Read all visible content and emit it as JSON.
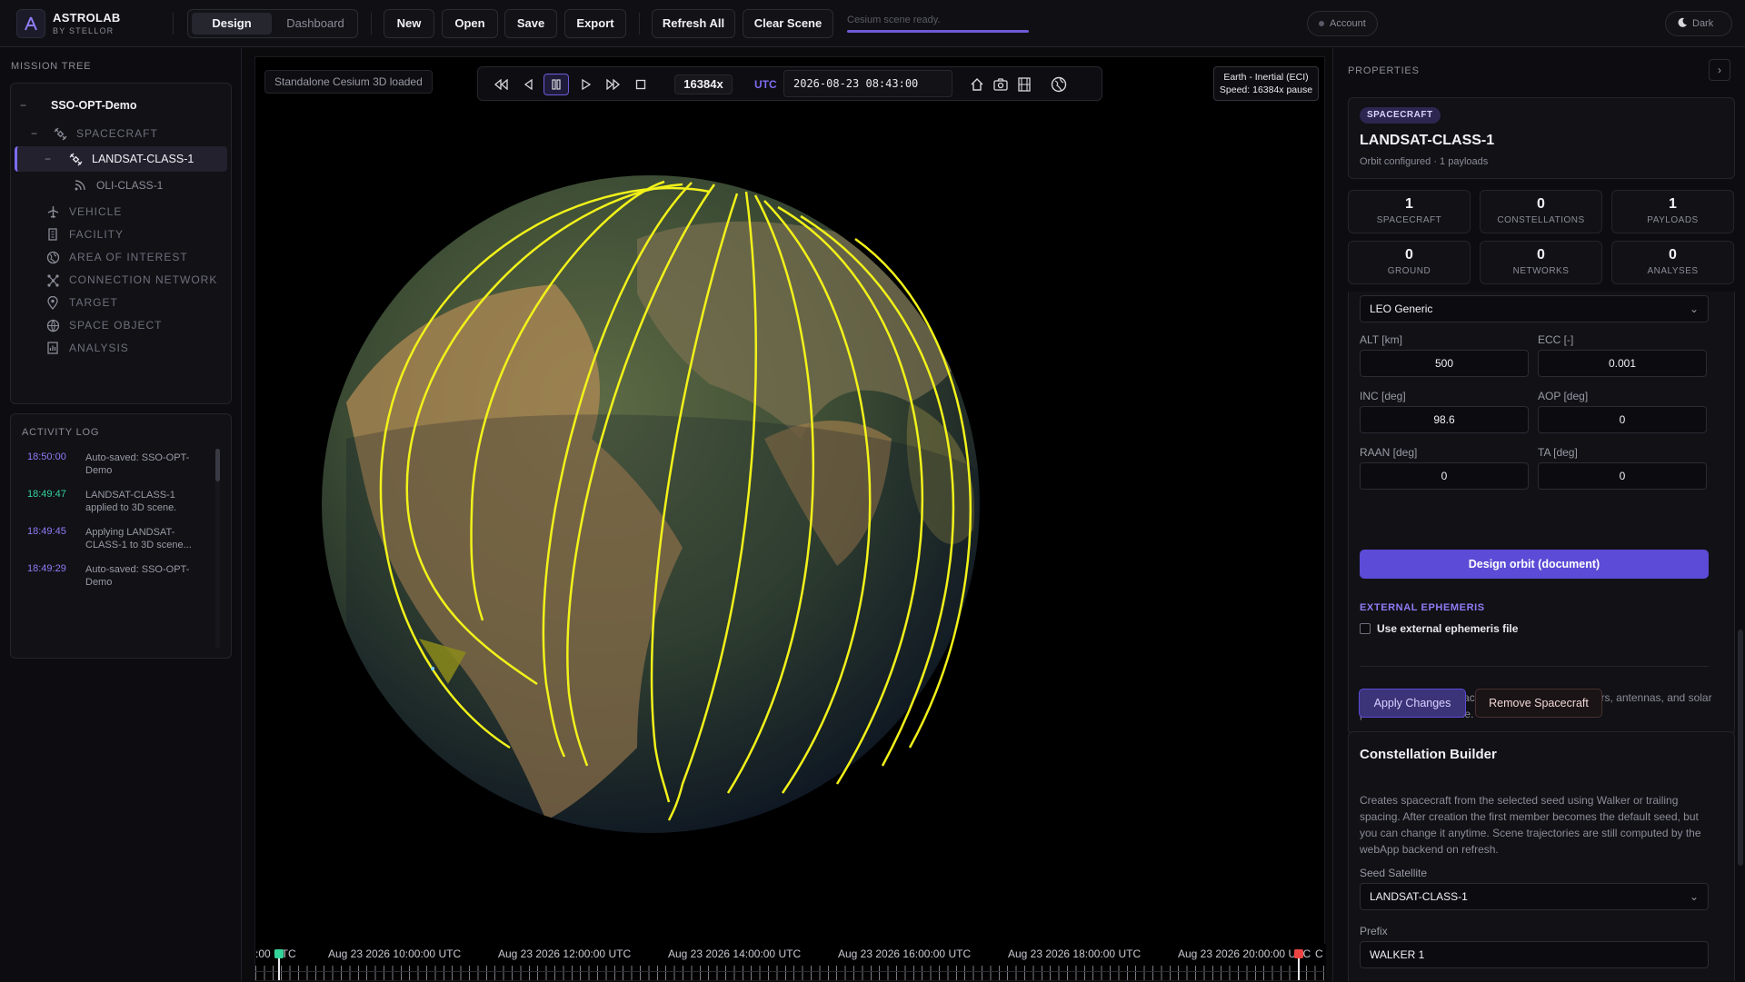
{
  "app": {
    "name": "ASTROLAB",
    "subtitle": "BY STELLOR"
  },
  "mode_toggle": {
    "design": "Design",
    "dashboard": "Dashboard"
  },
  "toolbar": {
    "new": "New",
    "open": "Open",
    "save": "Save",
    "export": "Export",
    "refresh_all": "Refresh All",
    "clear_scene": "Clear Scene"
  },
  "status": {
    "text": "Cesium scene ready.",
    "progress": 1.0
  },
  "account": {
    "label": "Account"
  },
  "theme": {
    "label": "Dark"
  },
  "mission_tree": {
    "title": "MISSION TREE",
    "root": "SSO-OPT-Demo",
    "spacecraft": "SPACECRAFT",
    "selected_sat": "LANDSAT-CLASS-1",
    "payload": "OLI-CLASS-1",
    "vehicle": "VEHICLE",
    "facility": "FACILITY",
    "area": "AREA OF INTEREST",
    "network": "CONNECTION NETWORK",
    "target": "TARGET",
    "space_object": "SPACE OBJECT",
    "analysis": "ANALYSIS"
  },
  "activity_log": {
    "title": "ACTIVITY LOG",
    "entries": [
      {
        "time": "18:50:00",
        "msg": "Auto-saved: SSO-OPT-Demo",
        "color": "#8f7cf5"
      },
      {
        "time": "18:49:47",
        "msg": "LANDSAT-CLASS-1 applied to 3D scene.",
        "color": "#34d399"
      },
      {
        "time": "18:49:45",
        "msg": "Applying LANDSAT-CLASS-1 to 3D scene...",
        "color": "#8f7cf5"
      },
      {
        "time": "18:49:29",
        "msg": "Auto-saved: SSO-OPT-Demo",
        "color": "#8f7cf5"
      }
    ]
  },
  "viewer": {
    "label": "Standalone Cesium 3D loaded",
    "speed": "16384x",
    "utc_label": "UTC",
    "datetime": "2026-08-23 08:43:00",
    "frame_line1": "Earth - Inertial (ECI)",
    "frame_line2": "Speed: 16384x pause",
    "timeline": {
      "start": ":00 UTC",
      "labels": [
        "Aug 23 2026 10:00:00 UTC",
        "Aug 23 2026 12:00:00 UTC",
        "Aug 23 2026 14:00:00 UTC",
        "Aug 23 2026 16:00:00 UTC",
        "Aug 23 2026 18:00:00 UTC",
        "Aug 23 2026 20:00:00 UTC"
      ],
      "end": "C"
    }
  },
  "properties": {
    "title": "PROPERTIES",
    "badge": "SPACECRAFT",
    "name": "LANDSAT-CLASS-1",
    "summary": "Orbit configured · 1 payloads",
    "stats": [
      {
        "value": "1",
        "label": "SPACECRAFT"
      },
      {
        "value": "0",
        "label": "CONSTELLATIONS"
      },
      {
        "value": "1",
        "label": "PAYLOADS"
      },
      {
        "value": "0",
        "label": "GROUND"
      },
      {
        "value": "0",
        "label": "NETWORKS"
      },
      {
        "value": "0",
        "label": "ANALYSES"
      }
    ],
    "orbit_template": "LEO Generic",
    "alt_label": "ALT [km]",
    "alt": "500",
    "ecc_label": "ECC [-]",
    "ecc": "0.001",
    "inc_label": "INC [deg]",
    "inc": "98.6",
    "aop_label": "AOP [deg]",
    "aop": "0",
    "raan_label": "RAAN [deg]",
    "raan": "0",
    "ta_label": "TA [deg]",
    "ta": "0",
    "design_orbit": "Design orbit (document)",
    "ext_header": "EXTERNAL EPHEMERIS",
    "ext_checkbox": "Use external ephemeris file",
    "apply_note": "Apply updates this spacecraft and mounted sensors, antennas, and solar panels in the 3D scene.",
    "apply": "Apply Changes",
    "remove": "Remove Spacecraft"
  },
  "constellation": {
    "title": "Constellation Builder",
    "desc": "Creates spacecraft from the selected seed using Walker or trailing spacing. After creation the first member becomes the default seed, but you can change it anytime. Scene trajectories are still computed by the webApp backend on refresh.",
    "seed_label": "Seed Satellite",
    "seed": "LANDSAT-CLASS-1",
    "prefix_label": "Prefix",
    "prefix": "WALKER 1"
  },
  "colors": {
    "accent": "#5b4bd6",
    "orbit": "#f2f21a",
    "log_green": "#34d399"
  }
}
